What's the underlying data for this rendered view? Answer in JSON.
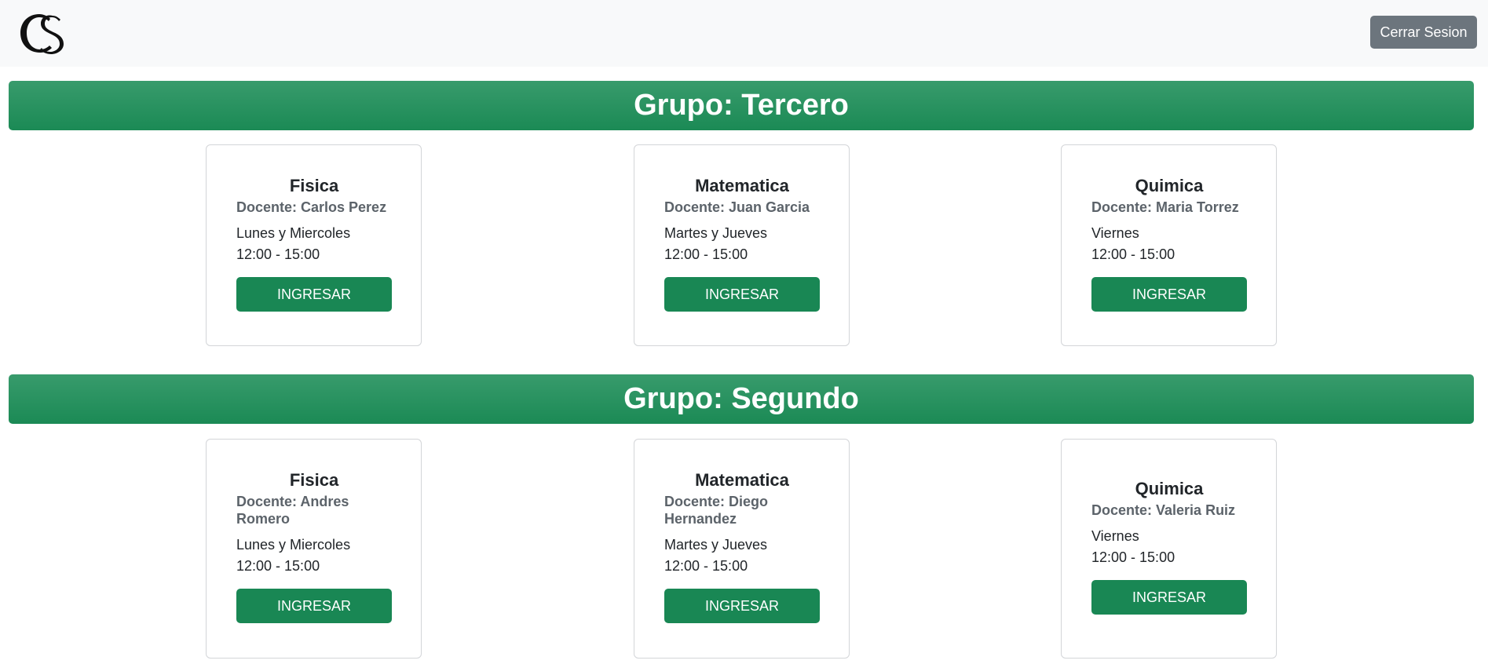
{
  "navbar": {
    "logo_text": "CS",
    "logout_label": "Cerrar Sesion"
  },
  "groups": [
    {
      "title": "Grupo: Tercero",
      "courses": [
        {
          "subject": "Fisica",
          "teacher": "Docente: Carlos Perez",
          "days": "Lunes y Miercoles",
          "hours": "12:00 - 15:00",
          "button": "INGRESAR"
        },
        {
          "subject": "Matematica",
          "teacher": "Docente: Juan Garcia",
          "days": "Martes y Jueves",
          "hours": "12:00 - 15:00",
          "button": "INGRESAR"
        },
        {
          "subject": "Quimica",
          "teacher": "Docente: Maria Torrez",
          "days": "Viernes",
          "hours": "12:00 - 15:00",
          "button": "INGRESAR"
        }
      ]
    },
    {
      "title": "Grupo: Segundo",
      "courses": [
        {
          "subject": "Fisica",
          "teacher": "Docente: Andres Romero",
          "days": "Lunes y Miercoles",
          "hours": "12:00 - 15:00",
          "button": "INGRESAR"
        },
        {
          "subject": "Matematica",
          "teacher": "Docente: Diego Hernandez",
          "days": "Martes y Jueves",
          "hours": "12:00 - 15:00",
          "button": "INGRESAR"
        },
        {
          "subject": "Quimica",
          "teacher": "Docente: Valeria Ruiz",
          "days": "Viernes",
          "hours": "12:00 - 15:00",
          "button": "INGRESAR"
        }
      ]
    }
  ],
  "colors": {
    "header_green": "#1f8b57",
    "button_green": "#198754",
    "logout_gray": "#6c757d"
  }
}
